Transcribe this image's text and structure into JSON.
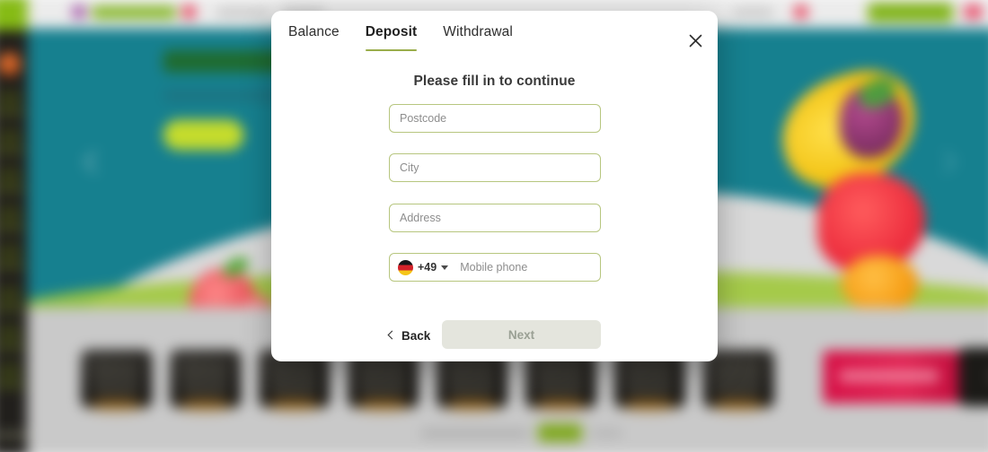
{
  "background": {
    "sidebar": {
      "name": "left-navigation-rail",
      "item_count": 9
    },
    "header": {
      "name": "site-header",
      "cta_label": ""
    },
    "hero": {
      "name": "promotional-banner"
    },
    "games_strip": {
      "name": "game-tiles-strip",
      "tile_count": 8
    }
  },
  "modal": {
    "tabs": [
      {
        "id": "balance",
        "label": "Balance",
        "active": false
      },
      {
        "id": "deposit",
        "label": "Deposit",
        "active": true
      },
      {
        "id": "withdrawal",
        "label": "Withdrawal",
        "active": false
      }
    ],
    "close_icon": "close-icon",
    "heading": "Please fill in to continue",
    "fields": [
      {
        "id": "postcode",
        "placeholder": "Postcode",
        "value": ""
      },
      {
        "id": "city",
        "placeholder": "City",
        "value": ""
      },
      {
        "id": "address",
        "placeholder": "Address",
        "value": ""
      }
    ],
    "phone_field": {
      "flag": "germany-flag-icon",
      "dial_code": "+49",
      "caret_icon": "chevron-down-icon",
      "placeholder": "Mobile phone",
      "value": ""
    },
    "actions": {
      "back_icon": "chevron-left-icon",
      "back_label": "Back",
      "next_label": "Next",
      "next_disabled": true
    }
  },
  "colors": {
    "accent_green": "#9aad4b",
    "field_border": "#b7c67f",
    "disabled_button_bg": "#e4e5dd",
    "disabled_button_text": "#9aa094",
    "hero_teal": "#16808f",
    "rail_dark": "#211f1c"
  }
}
